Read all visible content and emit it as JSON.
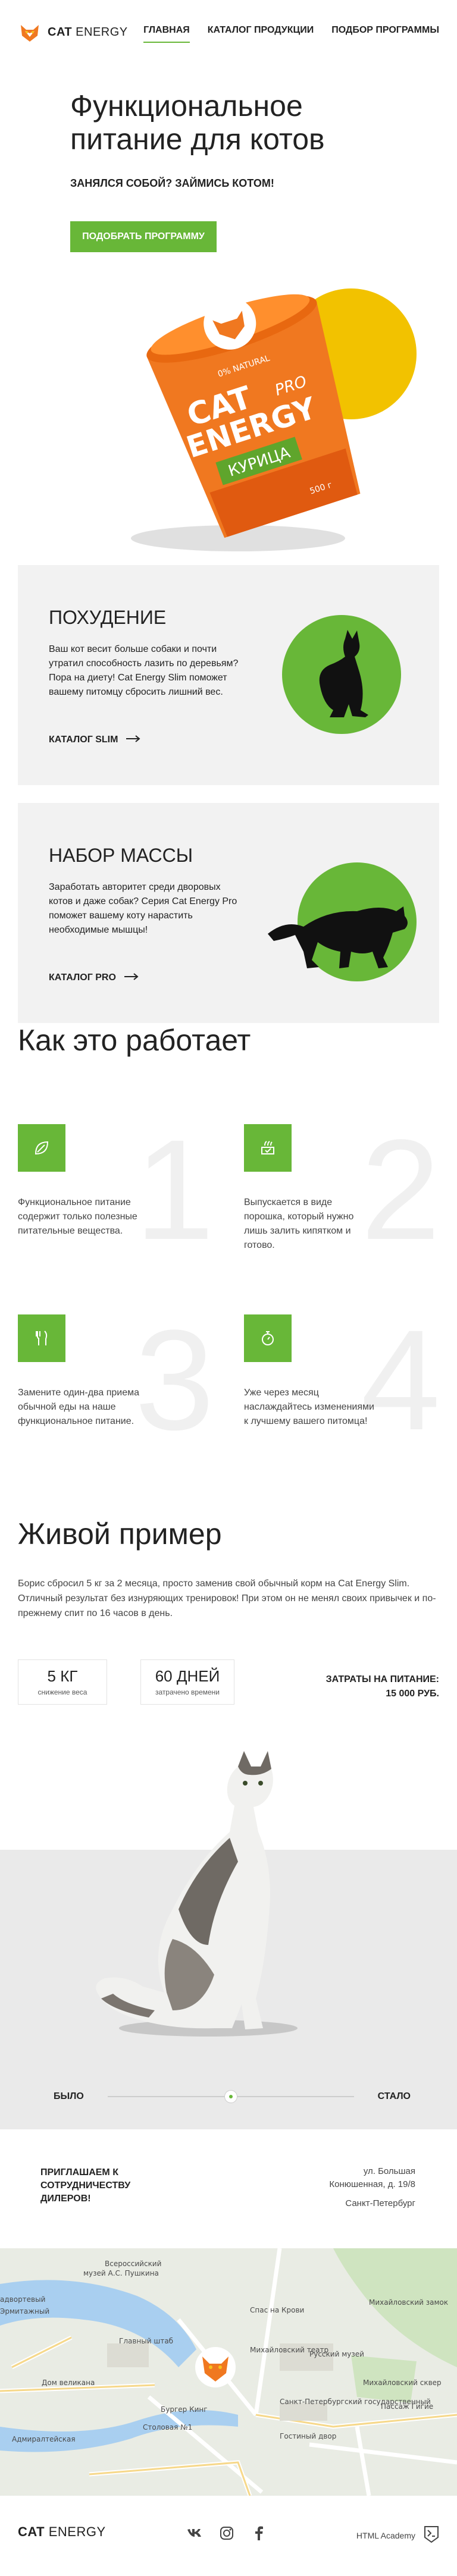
{
  "header": {
    "logo_text": "CAT",
    "logo_text_light": " ENERGY",
    "nav": [
      {
        "label": "Главная"
      },
      {
        "label": "Каталог продукции"
      },
      {
        "label": "Подбор программы"
      }
    ]
  },
  "hero": {
    "title": "Функциональное питание для котов",
    "subtitle": "Занялся собой? Займись котом!",
    "button_label": "Подобрать программу",
    "package": {
      "line1": "CAT",
      "line2": "ENERGY",
      "badge": "PRO",
      "natural": "0% NATURAL",
      "flavor": "КУРИЦА",
      "weight": "500 г"
    }
  },
  "catalog_cards": [
    {
      "title": "Похудение",
      "text": "Ваш кот весит больше собаки и почти утратил способность лазить по деревьям? Пора на диету! Cat Energy Slim поможет вашему питомцу сбросить лишний вес.",
      "link": "Каталог SLIM"
    },
    {
      "title": "Набор массы",
      "text": "Заработать авторитет среди дворовых котов и даже собак? Серия Cat Energy Pro поможет вашему коту нарастить необходимые мышцы!",
      "link": "Каталог PRO"
    }
  ],
  "how_it_works": {
    "title": "Как это работает",
    "steps": [
      {
        "number": "1",
        "text": "Функциональное питание содержит только полезные питательные вещества.",
        "icon": "leaf-icon"
      },
      {
        "number": "2",
        "text": "Выпускается в виде порошка, который нужно лишь залить кипятком и готово.",
        "icon": "bowl-icon"
      },
      {
        "number": "3",
        "text": "Замените один-два приема обычной еды на наше функциональное питание.",
        "icon": "cutlery-icon"
      },
      {
        "number": "4",
        "text": "Уже через месяц наслаждайтесь изменениями к лучшему вашего питомца!",
        "icon": "stopwatch-icon"
      }
    ]
  },
  "live_example": {
    "title": "Живой пример",
    "text": "Борис сбросил 5 кг за 2 месяца, просто заменив свой обычный корм на Cat Energy Slim. Отличный результат без изнуряющих тренировок! При этом он не менял своих привычек и по-прежнему спит по 16 часов в день.",
    "stats": [
      {
        "value": "5 КГ",
        "label": "снижение веса"
      },
      {
        "value": "60 ДНЕЙ",
        "label": "затрачено времени"
      }
    ],
    "total_label": "Затраты на питание:",
    "total_value": "15 000 руб.",
    "before_label": "Было",
    "after_label": "Стало",
    "slider_position": 0.5
  },
  "contacts": {
    "invite": "Приглашаем к сотрудничеству дилеров!",
    "address_line1": "ул. Большая",
    "address_line2": "Конюшенная, д. 19/8",
    "city": "Санкт-Петербург"
  },
  "map": {
    "labels": [
      {
        "text": "Всероссийский"
      },
      {
        "text": "музей А.С. Пушкина"
      },
      {
        "text": "адвортевый"
      },
      {
        "text": "Эрмитажный"
      },
      {
        "text": "Главный штаб"
      },
      {
        "text": "Спас на Крови"
      },
      {
        "text": "Михайловский замок"
      },
      {
        "text": "Михайловский театр"
      },
      {
        "text": "Русский музей"
      },
      {
        "text": "Дом великана"
      },
      {
        "text": "Бургер Кинг"
      },
      {
        "text": "Михайловский сквер"
      },
      {
        "text": "Столовая №1"
      },
      {
        "text": "Санкт-Петербургский государственный"
      },
      {
        "text": "Адмиралтейская"
      },
      {
        "text": "Пассаж Гигие"
      },
      {
        "text": "Гостиный двор"
      }
    ]
  },
  "footer": {
    "logo_text": "CAT",
    "logo_text_light": " ENERGY",
    "socials": [
      {
        "icon": "vk-icon"
      },
      {
        "icon": "instagram-icon"
      },
      {
        "icon": "facebook-icon"
      }
    ],
    "academy": "HTML Academy"
  },
  "colors": {
    "accent": "#68b738",
    "sun": "#f2c200",
    "package_orange": "#f07820"
  }
}
